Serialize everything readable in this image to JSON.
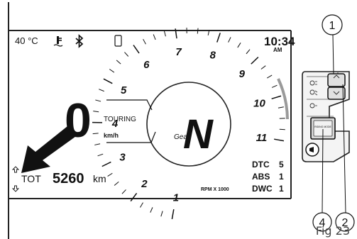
{
  "status": {
    "temperature": "40 °C",
    "time": "10:34",
    "meridiem": "AM",
    "icons": [
      "coolant-temperature-icon",
      "bluetooth-icon",
      "phone-icon"
    ]
  },
  "speed": {
    "value": "0",
    "unit": "km/h"
  },
  "riding_mode": "TOURING",
  "gear": {
    "label": "Gear",
    "value": "N"
  },
  "tach": {
    "labels": [
      "1",
      "2",
      "3",
      "4",
      "5",
      "6",
      "7",
      "8",
      "9",
      "10",
      "11"
    ],
    "unit": "RPM X 1000"
  },
  "odometer": {
    "label": "TOT",
    "value": "5260",
    "unit": "km"
  },
  "settings": [
    {
      "name": "DTC",
      "value": "5"
    },
    {
      "name": "ABS",
      "value": "1"
    },
    {
      "name": "DWC",
      "value": "1"
    }
  ],
  "callouts": [
    "1",
    "2",
    "4"
  ],
  "switch_labels": {
    "top": "MODE",
    "middle": "MODE",
    "button_text": "RIDING MODE"
  },
  "caption": "Fig 23"
}
